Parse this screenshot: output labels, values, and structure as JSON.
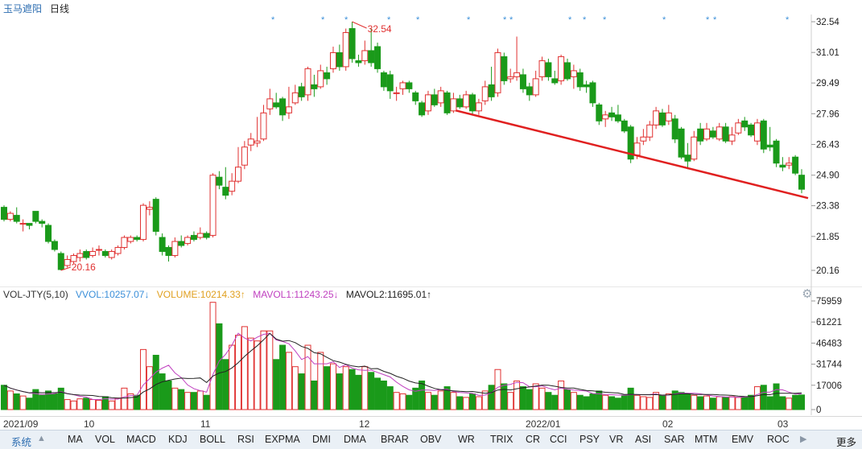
{
  "header": {
    "stock_name": "玉马遮阳",
    "period": "日线"
  },
  "colors": {
    "up": "#e03030",
    "down": "#1a9a1a",
    "trendline": "#e02020",
    "ma_short": "#c040c0",
    "ma_long": "#222222",
    "grid": "#e4e4e4",
    "stars": "#3b8fd9"
  },
  "price_panel": {
    "y_labels": [
      "32.54",
      "31.01",
      "29.49",
      "27.96",
      "26.43",
      "24.90",
      "23.38",
      "21.85",
      "20.16"
    ],
    "high_annotation": "32.54",
    "low_annotation": "20.16",
    "high_marker_icon": "triangle-arrow-icon",
    "low_marker_icon": "triangle-arrow-icon",
    "stars": [
      "*",
      "*",
      "*",
      "*",
      "*",
      "*",
      "*",
      "*",
      "*",
      "*",
      "*",
      "*",
      "*",
      "*",
      "*",
      "*",
      "*"
    ]
  },
  "volume_panel": {
    "legend": {
      "name": "VOL-JTY(5,10)",
      "vvol": "VVOL:10257.07↓",
      "volume": "VOLUME:10214.33↑",
      "mavol1": "MAVOL1:11243.25↓",
      "mavol2": "MAVOL2:11695.01↑"
    },
    "y_labels": [
      "75959",
      "61221",
      "46483",
      "31744",
      "17006",
      "0"
    ],
    "settings_icon": "gear-icon"
  },
  "date_axis": [
    "2021/09",
    "10",
    "11",
    "12",
    "2022/01",
    "02",
    "03"
  ],
  "toolbar": {
    "system_label": "系统",
    "items": [
      "MA",
      "VOL",
      "MACD",
      "KDJ",
      "BOLL",
      "RSI",
      "EXPMA",
      "DMI",
      "DMA",
      "BRAR",
      "OBV",
      "WR",
      "TRIX",
      "CR",
      "CCI",
      "PSY",
      "VR",
      "ASI",
      "SAR",
      "MTM",
      "EMV",
      "ROC"
    ],
    "more_label": "更多"
  },
  "chart_data": {
    "type": "candlestick",
    "title": "",
    "y_range": [
      20.16,
      32.54
    ],
    "volume_range": [
      0,
      75959
    ],
    "candles": [
      {
        "o": 23.3,
        "c": 22.7,
        "h": 23.4,
        "l": 22.6,
        "v": 17000
      },
      {
        "o": 22.7,
        "c": 23.0,
        "h": 23.1,
        "l": 22.6,
        "v": 13000
      },
      {
        "o": 22.9,
        "c": 22.6,
        "h": 23.3,
        "l": 22.5,
        "v": 11000
      },
      {
        "o": 22.5,
        "c": 22.5,
        "h": 22.7,
        "l": 22.1,
        "v": 9500
      },
      {
        "o": 22.5,
        "c": 22.4,
        "h": 22.5,
        "l": 22.2,
        "v": 8000
      },
      {
        "o": 23.1,
        "c": 22.6,
        "h": 23.1,
        "l": 22.5,
        "v": 14000
      },
      {
        "o": 22.6,
        "c": 22.5,
        "h": 22.7,
        "l": 22.3,
        "v": 10000
      },
      {
        "o": 22.4,
        "c": 21.6,
        "h": 22.5,
        "l": 21.5,
        "v": 13000
      },
      {
        "o": 21.6,
        "c": 21.2,
        "h": 21.7,
        "l": 21.1,
        "v": 11000
      },
      {
        "o": 21.0,
        "c": 20.2,
        "h": 21.1,
        "l": 20.16,
        "v": 15000
      },
      {
        "o": 20.4,
        "c": 20.7,
        "h": 20.9,
        "l": 20.3,
        "v": 7000
      },
      {
        "o": 20.6,
        "c": 20.9,
        "h": 21.0,
        "l": 20.5,
        "v": 6000
      },
      {
        "o": 20.8,
        "c": 21.0,
        "h": 21.2,
        "l": 20.6,
        "v": 7500
      },
      {
        "o": 21.1,
        "c": 20.8,
        "h": 21.2,
        "l": 20.7,
        "v": 8000
      },
      {
        "o": 20.9,
        "c": 21.1,
        "h": 21.3,
        "l": 20.8,
        "v": 7000
      },
      {
        "o": 21.2,
        "c": 21.2,
        "h": 21.4,
        "l": 20.9,
        "v": 6500
      },
      {
        "o": 21.1,
        "c": 20.9,
        "h": 21.2,
        "l": 20.8,
        "v": 9000
      },
      {
        "o": 20.8,
        "c": 21.1,
        "h": 21.2,
        "l": 20.7,
        "v": 6000
      },
      {
        "o": 21.0,
        "c": 21.3,
        "h": 21.4,
        "l": 20.9,
        "v": 8000
      },
      {
        "o": 21.3,
        "c": 21.8,
        "h": 21.9,
        "l": 21.2,
        "v": 15000
      },
      {
        "o": 21.6,
        "c": 21.8,
        "h": 21.9,
        "l": 21.5,
        "v": 11000
      },
      {
        "o": 21.8,
        "c": 21.7,
        "h": 21.9,
        "l": 21.6,
        "v": 10000
      },
      {
        "o": 21.7,
        "c": 23.4,
        "h": 23.5,
        "l": 21.6,
        "v": 42000
      },
      {
        "o": 23.2,
        "c": 23.3,
        "h": 23.6,
        "l": 22.9,
        "v": 30000
      },
      {
        "o": 23.7,
        "c": 22.1,
        "h": 23.8,
        "l": 21.9,
        "v": 38000
      },
      {
        "o": 21.8,
        "c": 21.1,
        "h": 22.0,
        "l": 20.9,
        "v": 25000
      },
      {
        "o": 21.3,
        "c": 20.9,
        "h": 21.4,
        "l": 20.6,
        "v": 20000
      },
      {
        "o": 20.9,
        "c": 21.6,
        "h": 21.8,
        "l": 20.8,
        "v": 15000
      },
      {
        "o": 21.6,
        "c": 21.4,
        "h": 21.9,
        "l": 21.3,
        "v": 14000
      },
      {
        "o": 21.5,
        "c": 21.8,
        "h": 21.9,
        "l": 21.4,
        "v": 12000
      },
      {
        "o": 21.9,
        "c": 21.7,
        "h": 22.1,
        "l": 21.6,
        "v": 12000
      },
      {
        "o": 21.8,
        "c": 22.0,
        "h": 22.3,
        "l": 21.7,
        "v": 13000
      },
      {
        "o": 22.0,
        "c": 21.8,
        "h": 22.1,
        "l": 21.7,
        "v": 10000
      },
      {
        "o": 21.9,
        "c": 24.9,
        "h": 25.0,
        "l": 21.8,
        "v": 75000
      },
      {
        "o": 24.8,
        "c": 24.4,
        "h": 25.1,
        "l": 24.2,
        "v": 60000
      },
      {
        "o": 24.3,
        "c": 23.9,
        "h": 25.3,
        "l": 23.7,
        "v": 35000
      },
      {
        "o": 24.1,
        "c": 24.6,
        "h": 25.0,
        "l": 23.9,
        "v": 45000
      },
      {
        "o": 24.6,
        "c": 25.3,
        "h": 26.3,
        "l": 24.5,
        "v": 52000
      },
      {
        "o": 25.4,
        "c": 26.3,
        "h": 26.6,
        "l": 25.2,
        "v": 58000
      },
      {
        "o": 26.4,
        "c": 26.7,
        "h": 27.0,
        "l": 26.1,
        "v": 50000
      },
      {
        "o": 26.5,
        "c": 26.6,
        "h": 27.8,
        "l": 26.3,
        "v": 48000
      },
      {
        "o": 26.7,
        "c": 28.0,
        "h": 28.4,
        "l": 26.6,
        "v": 55000
      },
      {
        "o": 28.2,
        "c": 28.7,
        "h": 29.2,
        "l": 27.9,
        "v": 55000
      },
      {
        "o": 28.5,
        "c": 28.3,
        "h": 29.0,
        "l": 28.2,
        "v": 35000
      },
      {
        "o": 28.7,
        "c": 27.9,
        "h": 28.8,
        "l": 27.6,
        "v": 45000
      },
      {
        "o": 28.0,
        "c": 28.3,
        "h": 29.3,
        "l": 27.7,
        "v": 40000
      },
      {
        "o": 28.5,
        "c": 29.0,
        "h": 29.4,
        "l": 28.4,
        "v": 30000
      },
      {
        "o": 29.3,
        "c": 28.8,
        "h": 29.5,
        "l": 28.6,
        "v": 25000
      },
      {
        "o": 28.9,
        "c": 30.2,
        "h": 30.3,
        "l": 28.6,
        "v": 45000
      },
      {
        "o": 29.4,
        "c": 29.2,
        "h": 29.9,
        "l": 28.8,
        "v": 20000
      },
      {
        "o": 29.3,
        "c": 30.1,
        "h": 30.4,
        "l": 29.2,
        "v": 40000
      },
      {
        "o": 30.0,
        "c": 29.7,
        "h": 30.3,
        "l": 29.4,
        "v": 30000
      },
      {
        "o": 30.2,
        "c": 31.0,
        "h": 31.3,
        "l": 30.0,
        "v": 32000
      },
      {
        "o": 31.0,
        "c": 30.3,
        "h": 31.4,
        "l": 30.1,
        "v": 25000
      },
      {
        "o": 30.3,
        "c": 32.0,
        "h": 32.2,
        "l": 30.1,
        "v": 30000
      },
      {
        "o": 32.2,
        "c": 30.7,
        "h": 32.54,
        "l": 30.5,
        "v": 28000
      },
      {
        "o": 30.6,
        "c": 30.5,
        "h": 30.9,
        "l": 30.3,
        "v": 24000
      },
      {
        "o": 30.6,
        "c": 31.1,
        "h": 31.6,
        "l": 30.4,
        "v": 30000
      },
      {
        "o": 31.1,
        "c": 30.5,
        "h": 32.2,
        "l": 30.3,
        "v": 26000
      },
      {
        "o": 31.3,
        "c": 30.2,
        "h": 31.5,
        "l": 30.0,
        "v": 22000
      },
      {
        "o": 30.0,
        "c": 29.3,
        "h": 30.1,
        "l": 29.1,
        "v": 20000
      },
      {
        "o": 29.9,
        "c": 29.1,
        "h": 30.1,
        "l": 28.7,
        "v": 16000
      },
      {
        "o": 29.0,
        "c": 29.0,
        "h": 29.3,
        "l": 28.6,
        "v": 12000
      },
      {
        "o": 29.2,
        "c": 29.5,
        "h": 29.6,
        "l": 28.9,
        "v": 11000
      },
      {
        "o": 29.5,
        "c": 29.2,
        "h": 29.6,
        "l": 29.0,
        "v": 10000
      },
      {
        "o": 29.0,
        "c": 28.6,
        "h": 29.1,
        "l": 28.4,
        "v": 15000
      },
      {
        "o": 28.5,
        "c": 27.9,
        "h": 28.6,
        "l": 27.8,
        "v": 20000
      },
      {
        "o": 28.1,
        "c": 28.9,
        "h": 29.1,
        "l": 27.9,
        "v": 12000
      },
      {
        "o": 28.9,
        "c": 28.4,
        "h": 29.2,
        "l": 28.3,
        "v": 10000
      },
      {
        "o": 28.5,
        "c": 29.1,
        "h": 29.3,
        "l": 28.3,
        "v": 13000
      },
      {
        "o": 29.0,
        "c": 28.0,
        "h": 29.1,
        "l": 27.9,
        "v": 16000
      },
      {
        "o": 28.1,
        "c": 28.7,
        "h": 29.0,
        "l": 28.0,
        "v": 12000
      },
      {
        "o": 28.7,
        "c": 28.3,
        "h": 28.9,
        "l": 28.2,
        "v": 9000
      },
      {
        "o": 28.3,
        "c": 28.9,
        "h": 29.1,
        "l": 28.2,
        "v": 8500
      },
      {
        "o": 28.9,
        "c": 28.1,
        "h": 29.0,
        "l": 27.9,
        "v": 11000
      },
      {
        "o": 28.1,
        "c": 28.5,
        "h": 28.7,
        "l": 27.9,
        "v": 9000
      },
      {
        "o": 28.6,
        "c": 29.3,
        "h": 29.6,
        "l": 28.4,
        "v": 13000
      },
      {
        "o": 29.4,
        "c": 28.8,
        "h": 30.3,
        "l": 28.6,
        "v": 17000
      },
      {
        "o": 29.0,
        "c": 31.0,
        "h": 31.2,
        "l": 28.8,
        "v": 28000
      },
      {
        "o": 30.8,
        "c": 29.6,
        "h": 31.0,
        "l": 29.4,
        "v": 18000
      },
      {
        "o": 29.7,
        "c": 29.8,
        "h": 30.2,
        "l": 29.5,
        "v": 12000
      },
      {
        "o": 29.8,
        "c": 30.0,
        "h": 31.8,
        "l": 29.6,
        "v": 20000
      },
      {
        "o": 29.9,
        "c": 29.2,
        "h": 30.2,
        "l": 29.0,
        "v": 16000
      },
      {
        "o": 29.3,
        "c": 28.9,
        "h": 29.5,
        "l": 28.6,
        "v": 14000
      },
      {
        "o": 28.9,
        "c": 29.7,
        "h": 30.1,
        "l": 28.8,
        "v": 18000
      },
      {
        "o": 29.8,
        "c": 30.6,
        "h": 30.8,
        "l": 29.6,
        "v": 15000
      },
      {
        "o": 30.5,
        "c": 29.8,
        "h": 30.7,
        "l": 29.6,
        "v": 12000
      },
      {
        "o": 29.7,
        "c": 29.5,
        "h": 30.1,
        "l": 29.4,
        "v": 10000
      },
      {
        "o": 29.6,
        "c": 30.8,
        "h": 30.9,
        "l": 29.4,
        "v": 20000
      },
      {
        "o": 30.5,
        "c": 29.7,
        "h": 30.7,
        "l": 29.6,
        "v": 14000
      },
      {
        "o": 29.8,
        "c": 30.1,
        "h": 30.4,
        "l": 29.2,
        "v": 12000
      },
      {
        "o": 30.0,
        "c": 29.3,
        "h": 30.2,
        "l": 29.1,
        "v": 10000
      },
      {
        "o": 29.4,
        "c": 29.3,
        "h": 29.6,
        "l": 29.0,
        "v": 9000
      },
      {
        "o": 29.5,
        "c": 28.5,
        "h": 29.6,
        "l": 28.3,
        "v": 11000
      },
      {
        "o": 28.4,
        "c": 27.6,
        "h": 28.5,
        "l": 27.4,
        "v": 13000
      },
      {
        "o": 27.7,
        "c": 27.9,
        "h": 28.1,
        "l": 27.3,
        "v": 10000
      },
      {
        "o": 28.0,
        "c": 27.8,
        "h": 28.3,
        "l": 27.6,
        "v": 9000
      },
      {
        "o": 27.9,
        "c": 27.6,
        "h": 28.4,
        "l": 27.5,
        "v": 8000
      },
      {
        "o": 27.6,
        "c": 27.1,
        "h": 27.7,
        "l": 27.0,
        "v": 10000
      },
      {
        "o": 27.3,
        "c": 25.7,
        "h": 27.4,
        "l": 25.5,
        "v": 15000
      },
      {
        "o": 25.9,
        "c": 26.5,
        "h": 26.8,
        "l": 25.7,
        "v": 10000
      },
      {
        "o": 26.6,
        "c": 26.8,
        "h": 27.2,
        "l": 26.4,
        "v": 9000
      },
      {
        "o": 26.8,
        "c": 27.4,
        "h": 27.6,
        "l": 26.6,
        "v": 8500
      },
      {
        "o": 27.4,
        "c": 28.1,
        "h": 28.3,
        "l": 27.2,
        "v": 12000
      },
      {
        "o": 28.0,
        "c": 27.4,
        "h": 28.2,
        "l": 27.3,
        "v": 10000
      },
      {
        "o": 27.6,
        "c": 28.0,
        "h": 28.4,
        "l": 27.4,
        "v": 11000
      },
      {
        "o": 27.7,
        "c": 26.7,
        "h": 27.9,
        "l": 26.5,
        "v": 13000
      },
      {
        "o": 27.2,
        "c": 25.8,
        "h": 27.3,
        "l": 25.7,
        "v": 12000
      },
      {
        "o": 25.9,
        "c": 25.6,
        "h": 26.5,
        "l": 25.2,
        "v": 11000
      },
      {
        "o": 25.7,
        "c": 26.8,
        "h": 27.1,
        "l": 25.6,
        "v": 10000
      },
      {
        "o": 27.2,
        "c": 26.6,
        "h": 27.5,
        "l": 26.4,
        "v": 9000
      },
      {
        "o": 26.7,
        "c": 27.2,
        "h": 27.5,
        "l": 26.6,
        "v": 9500
      },
      {
        "o": 27.1,
        "c": 26.8,
        "h": 27.3,
        "l": 26.7,
        "v": 8000
      },
      {
        "o": 26.7,
        "c": 27.3,
        "h": 27.5,
        "l": 26.6,
        "v": 9000
      },
      {
        "o": 27.3,
        "c": 26.6,
        "h": 27.5,
        "l": 26.5,
        "v": 8500
      },
      {
        "o": 26.6,
        "c": 26.9,
        "h": 27.3,
        "l": 26.4,
        "v": 9000
      },
      {
        "o": 27.0,
        "c": 27.5,
        "h": 27.7,
        "l": 26.9,
        "v": 8500
      },
      {
        "o": 27.6,
        "c": 27.3,
        "h": 27.8,
        "l": 27.1,
        "v": 9000
      },
      {
        "o": 27.4,
        "c": 26.9,
        "h": 27.5,
        "l": 26.8,
        "v": 10000
      },
      {
        "o": 26.6,
        "c": 27.5,
        "h": 27.7,
        "l": 26.4,
        "v": 16000
      },
      {
        "o": 27.6,
        "c": 26.2,
        "h": 27.7,
        "l": 26.0,
        "v": 17000
      },
      {
        "o": 26.4,
        "c": 26.3,
        "h": 27.3,
        "l": 26.1,
        "v": 9000
      },
      {
        "o": 26.6,
        "c": 25.5,
        "h": 26.7,
        "l": 25.3,
        "v": 18000
      },
      {
        "o": 25.4,
        "c": 25.3,
        "h": 25.8,
        "l": 25.1,
        "v": 9000
      },
      {
        "o": 25.4,
        "c": 25.5,
        "h": 25.8,
        "l": 25.2,
        "v": 8000
      },
      {
        "o": 25.8,
        "c": 25.0,
        "h": 25.9,
        "l": 24.9,
        "v": 10000
      },
      {
        "o": 24.9,
        "c": 24.2,
        "h": 25.2,
        "l": 24.0,
        "v": 10214
      }
    ]
  }
}
